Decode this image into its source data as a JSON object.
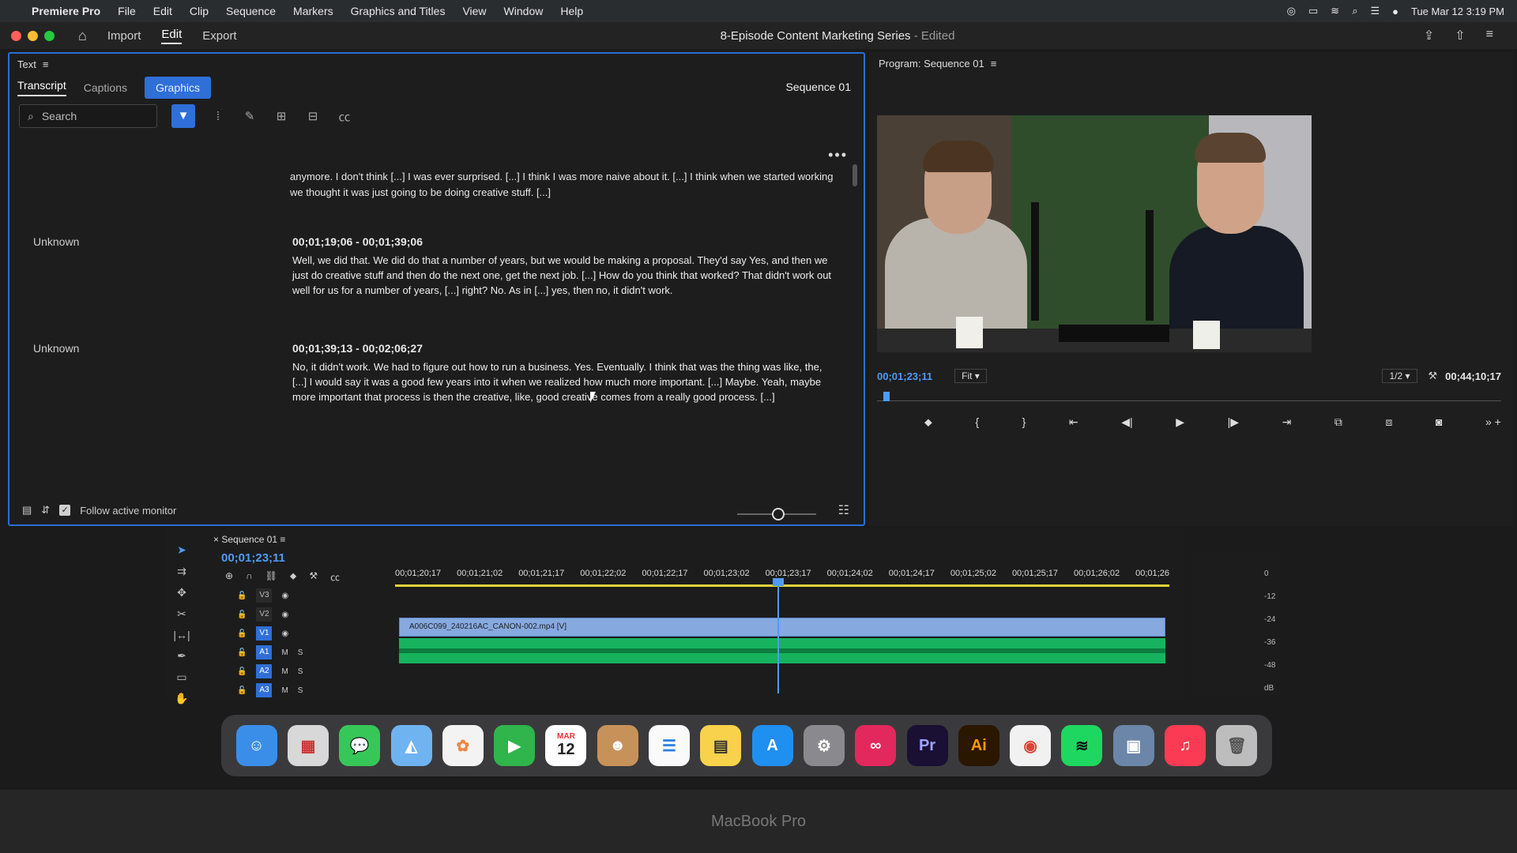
{
  "menubar": {
    "app_name": "Premiere Pro",
    "items": [
      "File",
      "Edit",
      "Clip",
      "Sequence",
      "Markers",
      "Graphics and Titles",
      "View",
      "Window",
      "Help"
    ],
    "datetime": "Tue Mar 12  3:19 PM"
  },
  "titlebar": {
    "workspaces": [
      "Import",
      "Edit",
      "Export"
    ],
    "active_workspace": "Edit",
    "project_title": "8-Episode Content Marketing Series",
    "project_status": "- Edited"
  },
  "text_panel": {
    "title": "Text",
    "tabs": [
      "Transcript",
      "Captions",
      "Graphics"
    ],
    "sequence_label": "Sequence 01",
    "search_placeholder": "Search",
    "fragment": "anymore. I don't think [...] I was ever surprised. [...] I think I was more naive about it. [...] I think when we started working we thought it was just going to be doing creative stuff. [...]",
    "entries": [
      {
        "speaker": "Unknown",
        "timecode": "00;01;19;06 - 00;01;39;06",
        "text": "Well, we did that. We did do that a number of years, but we would be making a proposal. They'd say Yes, and then we just do creative stuff and then do the next one, get the next job. [...] How do you think that worked? That didn't work out well for us for a number of years, [...] right? No. As in [...] yes, then no, it didn't work."
      },
      {
        "speaker": "Unknown",
        "timecode": "00;01;39;13 - 00;02;06;27",
        "text": "No, it didn't work. We had to figure out how to run a business. Yes. Eventually. I think that was the thing was like, the, [...] I would say it was a good few years into it when we realized how much more important. [...] Maybe. Yeah, maybe more important that process is then the creative, like, good creative comes from a really good process. [...]"
      }
    ],
    "follow_label": "Follow active monitor"
  },
  "program": {
    "title": "Program: Sequence 01",
    "timecode": "00;01;23;11",
    "fit": "Fit",
    "resolution": "1/2",
    "duration": "00;44;10;17"
  },
  "timeline": {
    "sequence": "Sequence 01",
    "timecode": "00;01;23;11",
    "ruler": [
      "00;01;20;17",
      "00;01;21;02",
      "00;01;21;17",
      "00;01;22;02",
      "00;01;22;17",
      "00;01;23;02",
      "00;01;23;17",
      "00;01;24;02",
      "00;01;24;17",
      "00;01;25;02",
      "00;01;25;17",
      "00;01;26;02",
      "00;01;26"
    ],
    "tracks": [
      "V3",
      "V2",
      "V1",
      "A1",
      "A2",
      "A3"
    ],
    "clip_name": "A006C099_240216AC_CANON-002.mp4 [V]"
  },
  "meter_scale": [
    "0",
    "-12",
    "-24",
    "-36",
    "-48",
    "dB"
  ],
  "dock": [
    "Finder",
    "Launchpad",
    "Messages",
    "Maps",
    "Photos",
    "FaceTime",
    "Calendar",
    "Contacts",
    "Reminders",
    "Notes",
    "App Store",
    "System Settings",
    "Creative Cloud",
    "Pr",
    "Ai",
    "Chrome",
    "Spotify",
    "Preview",
    "Music",
    "Trash"
  ],
  "calendar_icon": {
    "month": "MAR",
    "day": "12"
  },
  "bezel_label": "MacBook Pro"
}
